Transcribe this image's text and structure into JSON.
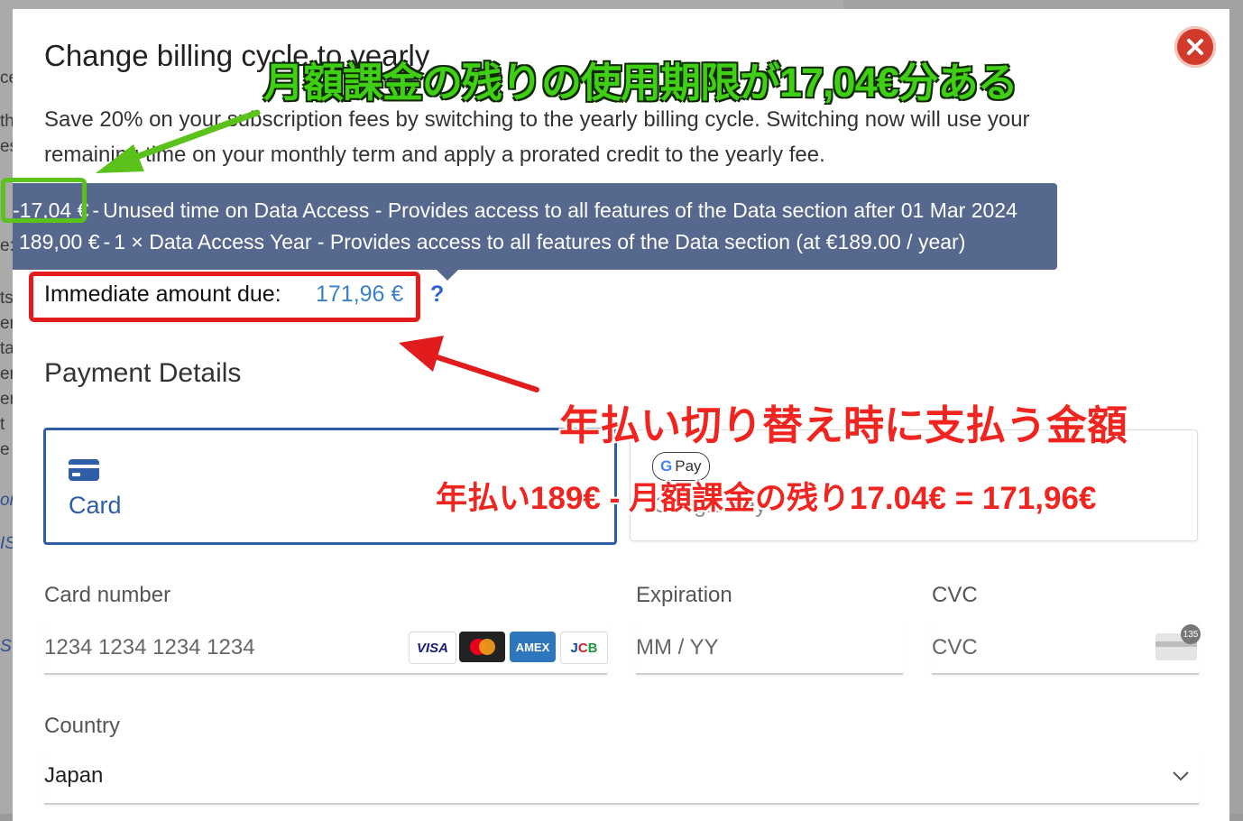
{
  "background": {
    "fragments": [
      "ce",
      "th",
      "es",
      "e:",
      "ts",
      "er",
      "ta",
      "er",
      "er",
      "t",
      "e",
      "or",
      "IS",
      "S"
    ]
  },
  "dialog": {
    "title": "Change billing cycle to yearly",
    "description": "Save 20% on your subscription fees by switching to the yearly billing cycle. Switching now will use your remaining time on your monthly term and apply a prorated credit to the yearly fee.",
    "close_icon": "close-icon"
  },
  "tooltip": {
    "line1_amount": "-17,04 €",
    "line1_text": "Unused time on Data Access - Provides access to all features of the Data section after 01 Mar 2024",
    "line2_amount": "189,00 €",
    "line2_text": "1 × Data Access Year - Provides access to all features of the Data section (at €189.00 / year)",
    "separator": "-"
  },
  "amount_due": {
    "label": "Immediate amount due:",
    "value": "171,96 €",
    "help": "?"
  },
  "payment": {
    "title": "Payment Details",
    "tabs": [
      {
        "label": "Card",
        "icon": "credit-card-icon",
        "selected": true
      },
      {
        "label": "Google Pay",
        "badge": "Pay",
        "icon": "google-pay-icon",
        "selected": false
      }
    ],
    "card_number": {
      "label": "Card number",
      "placeholder": "1234 1234 1234 1234",
      "brands": [
        "VISA",
        "Mastercard",
        "AMEX",
        "JCB"
      ]
    },
    "expiration": {
      "label": "Expiration",
      "placeholder": "MM / YY"
    },
    "cvc": {
      "label": "CVC",
      "placeholder": "CVC",
      "badge": "135"
    },
    "country": {
      "label": "Country",
      "value": "Japan"
    }
  },
  "annotations": {
    "green_text": "月額課金の残りの使用期限が17,04€分ある",
    "red_text_1": "年払い切り替え時に支払う金額",
    "red_text_2": "年払い189€ - 月額課金の残り17.04€ = 171,96€",
    "green_color": "#5bc11b",
    "red_color": "#e21c1c"
  },
  "colors": {
    "accent": "#2f5ea8",
    "amount": "#3a80c8",
    "tooltip_bg": "#56688e",
    "close": "#d23a2c"
  }
}
